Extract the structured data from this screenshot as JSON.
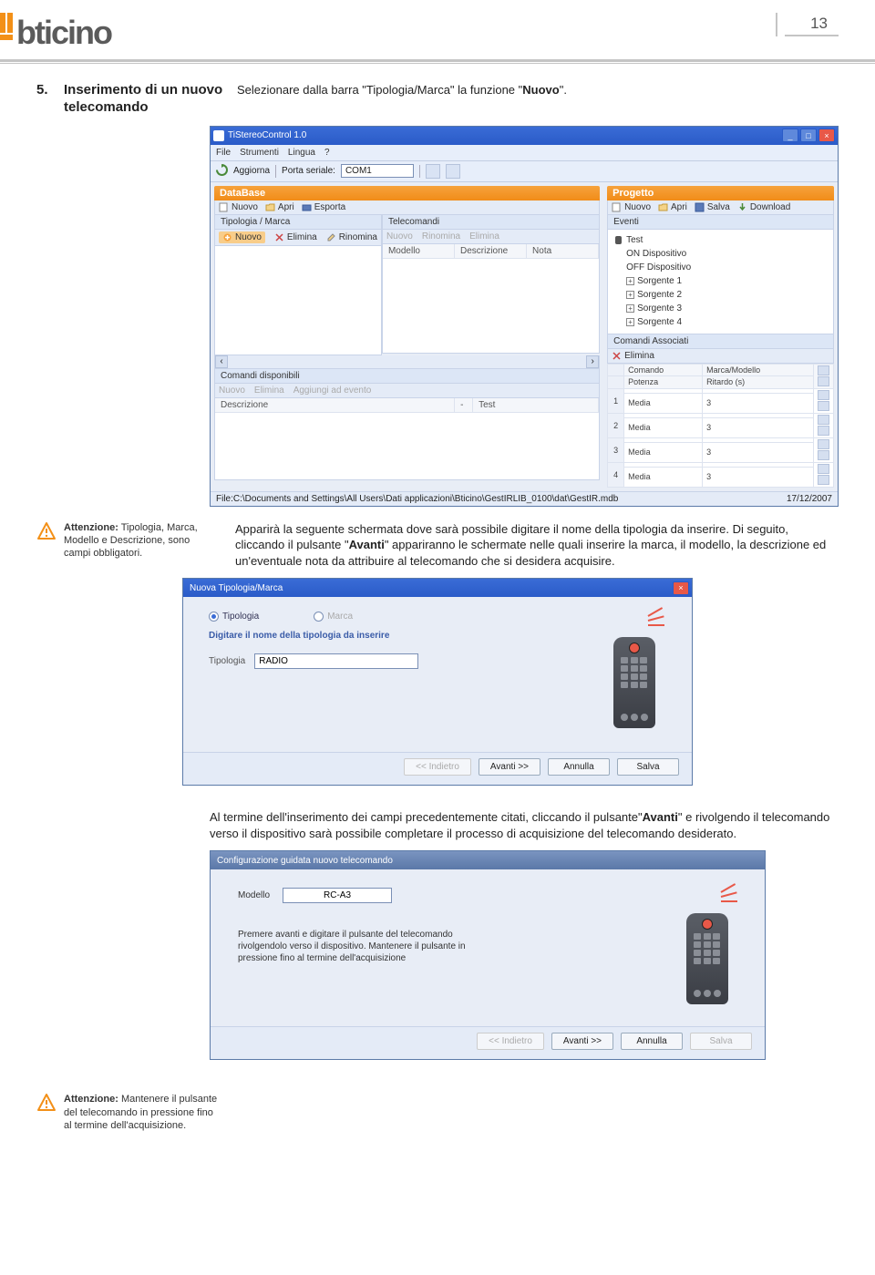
{
  "page": {
    "number": "13"
  },
  "section": {
    "num": "5.",
    "title": "Inserimento di un nuovo telecomando",
    "desc_pre": "Selezionare dalla barra \"Tipologia/Marca\" la funzione \"",
    "desc_bold": "Nuovo",
    "desc_post": "\"."
  },
  "app": {
    "title": "TiStereoControl 1.0",
    "menu": [
      "File",
      "Strumenti",
      "Lingua",
      "?"
    ],
    "toolbar": {
      "refresh": "Aggiorna",
      "port": "Porta seriale:",
      "port_value": "COM1"
    },
    "database": {
      "title": "DataBase",
      "buttons": [
        "Nuovo",
        "Apri",
        "Esporta"
      ],
      "tipologia": {
        "header": "Tipologia / Marca",
        "buttons": {
          "nuovo": "Nuovo",
          "elimina": "Elimina",
          "rinomina": "Rinomina"
        }
      },
      "telecomandi": {
        "header": "Telecomandi",
        "buttons_disabled": [
          "Nuovo",
          "Rinomina",
          "Elimina"
        ],
        "cols": [
          "Modello",
          "Descrizione",
          "Nota"
        ]
      },
      "comandi": {
        "header": "Comandi disponibili",
        "buttons_disabled": [
          "Nuovo",
          "Elimina",
          "Aggiungi ad evento"
        ],
        "cols": [
          "Descrizione",
          "-",
          "Test"
        ]
      }
    },
    "progetto": {
      "title": "Progetto",
      "buttons": [
        "Nuovo",
        "Apri",
        "Salva",
        "Download"
      ],
      "eventi": {
        "header": "Eventi",
        "root": "Test",
        "items": [
          "ON Dispositivo",
          "OFF Dispositivo",
          "Sorgente 1",
          "Sorgente 2",
          "Sorgente 3",
          "Sorgente 4"
        ]
      },
      "associati": {
        "header": "Comandi Associati",
        "elimina": "Elimina",
        "cols": [
          "Comando",
          "Marca/Modello",
          "Potenza",
          "Ritardo (s)"
        ],
        "rows": [
          {
            "n": "1",
            "c1": "Media",
            "c2": "3"
          },
          {
            "n": "2",
            "c1": "Media",
            "c2": "3"
          },
          {
            "n": "3",
            "c1": "Media",
            "c2": "3"
          },
          {
            "n": "4",
            "c1": "Media",
            "c2": "3"
          }
        ]
      }
    },
    "status": {
      "file_label": "File:",
      "file_path": "C:\\Documents and Settings\\All Users\\Dati applicazioni\\Bticino\\GestIRLIB_0100\\dat\\GestIR.mdb",
      "date": "17/12/2007"
    }
  },
  "warning1": {
    "label": "Attenzione:",
    "text": " Tipologia, Marca, Modello e Descrizione, sono campi obbligatori."
  },
  "para1_pre": "Apparirà la seguente schermata dove sarà possibile digitare il nome della tipologia da inserire. Di seguito, cliccando il pulsante \"",
  "para1_bold": "Avanti",
  "para1_post": "\" appariranno le schermate nelle quali inserire la marca, il modello, la descrizione ed un'eventuale nota da attribuire al telecomando che si desidera acquisire.",
  "dialog2": {
    "title": "Nuova Tipologia/Marca",
    "radio1": "Tipologia",
    "radio2": "Marca",
    "prompt": "Digitare il nome della tipologia da inserire",
    "label": "Tipologia",
    "value": "RADIO",
    "buttons": {
      "back": "<< Indietro",
      "next": "Avanti >>",
      "cancel": "Annulla",
      "save": "Salva"
    }
  },
  "para2_pre": "Al termine dell'inserimento dei campi precedentemente citati, cliccando il pulsante\"",
  "para2_bold": "Avanti",
  "para2_post": "\" e rivolgendo il telecomando verso il dispositivo sarà possibile completare il processo di acquisizione del telecomando desiderato.",
  "dialog3": {
    "title": "Configurazione guidata nuovo telecomando",
    "label": "Modello",
    "value": "RC-A3",
    "instructions": "Premere avanti e digitare il pulsante del telecomando rivolgendolo verso il dispositivo. Mantenere il pulsante in pressione fino al termine dell'acquisizione",
    "buttons": {
      "back": "<< Indietro",
      "next": "Avanti >>",
      "cancel": "Annulla",
      "save": "Salva"
    }
  },
  "warning2": {
    "label": "Attenzione:",
    "text": " Mantenere il pulsante del telecomando in pressione fino al termine dell'acquisizione."
  }
}
